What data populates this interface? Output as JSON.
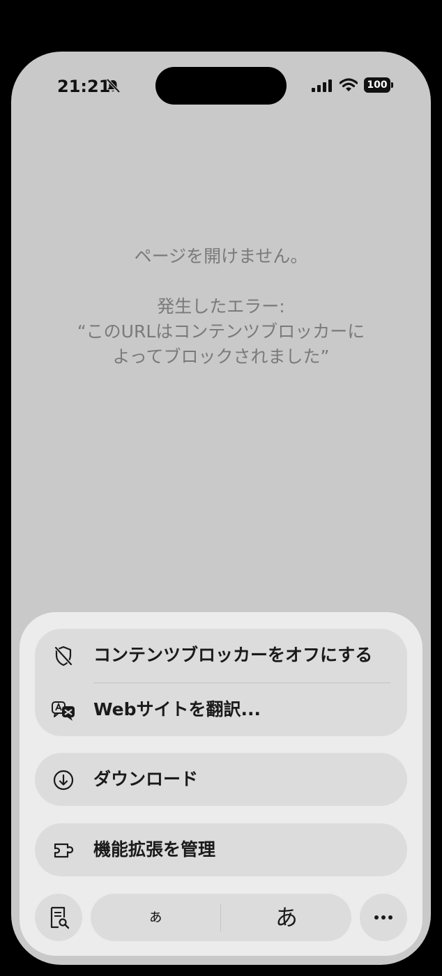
{
  "status_bar": {
    "time": "21:21",
    "battery": "100",
    "icons": [
      "bell-slash-icon",
      "cellular-signal-icon",
      "wifi-icon",
      "battery-icon"
    ]
  },
  "error": {
    "line1": "ページを開けません。",
    "line2": "発生したエラー:",
    "line3": "“このURLはコンテンツブロッカーに",
    "line4": "よってブロックされました”"
  },
  "menu": {
    "content_blocker_off": "コンテンツブロッカーをオフにする",
    "translate_website": "Webサイトを翻訳...",
    "download": "ダウンロード",
    "manage_extensions": "機能拡張を管理"
  },
  "bottom_bar": {
    "text_smaller": "ぁ",
    "text_larger": "あ",
    "icons": [
      "reader-icon",
      "ellipsis-icon"
    ]
  },
  "colors": {
    "background": "#000000",
    "page": "#c9c9c9",
    "sheet": "#ececec",
    "group": "#dcdcdc",
    "label": "#1a1a1a",
    "error_text": "#7a7a7a"
  }
}
